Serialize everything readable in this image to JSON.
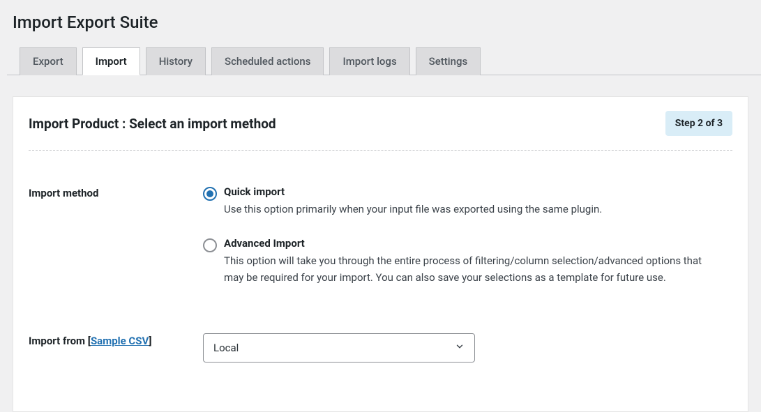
{
  "header": {
    "title": "Import Export Suite"
  },
  "tabs": [
    {
      "label": "Export",
      "active": false
    },
    {
      "label": "Import",
      "active": true
    },
    {
      "label": "History",
      "active": false
    },
    {
      "label": "Scheduled actions",
      "active": false
    },
    {
      "label": "Import logs",
      "active": false
    },
    {
      "label": "Settings",
      "active": false
    }
  ],
  "step": {
    "title": "Import Product : Select an import method",
    "badge": "Step 2 of 3"
  },
  "import_method": {
    "label": "Import method",
    "options": [
      {
        "title": "Quick import",
        "desc": "Use this option primarily when your input file was exported using the same plugin.",
        "checked": true
      },
      {
        "title": "Advanced Import",
        "desc": "This option will take you through the entire process of filtering/column selection/advanced options that may be required for your import. You can also save your selections as a template for future use.",
        "checked": false
      }
    ]
  },
  "import_from": {
    "label_prefix": "Import from ",
    "sample_link": "Sample CSV",
    "select_value": "Local"
  }
}
